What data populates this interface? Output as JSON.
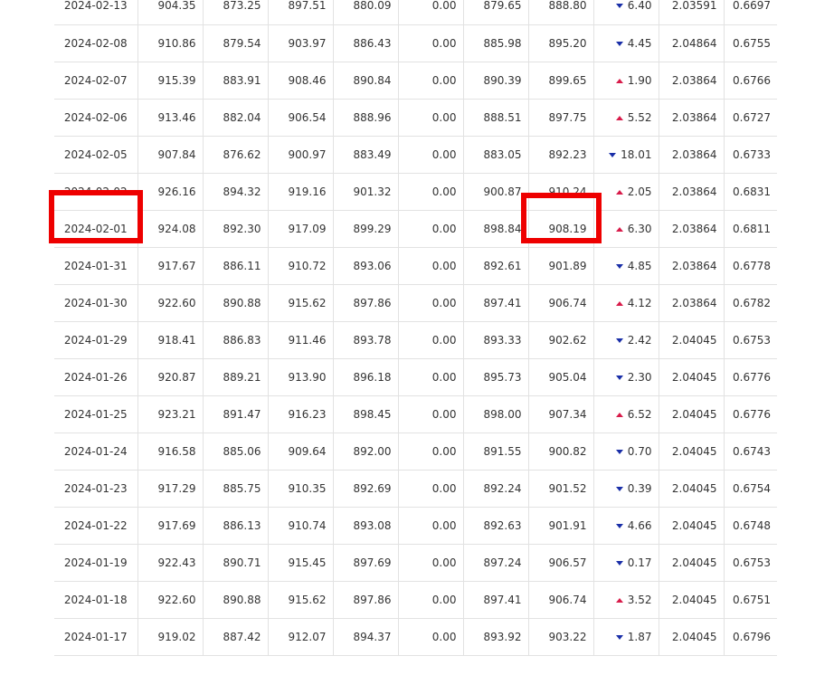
{
  "rows": [
    {
      "date": "2024-02-13",
      "c1": "904.35",
      "c2": "873.25",
      "c3": "897.51",
      "c4": "880.09",
      "c5": "0.00",
      "c6": "879.65",
      "c7": "888.80",
      "dir": "down",
      "chg": "6.40",
      "c9": "2.03591",
      "c10": "0.6697"
    },
    {
      "date": "2024-02-08",
      "c1": "910.86",
      "c2": "879.54",
      "c3": "903.97",
      "c4": "886.43",
      "c5": "0.00",
      "c6": "885.98",
      "c7": "895.20",
      "dir": "down",
      "chg": "4.45",
      "c9": "2.04864",
      "c10": "0.6755"
    },
    {
      "date": "2024-02-07",
      "c1": "915.39",
      "c2": "883.91",
      "c3": "908.46",
      "c4": "890.84",
      "c5": "0.00",
      "c6": "890.39",
      "c7": "899.65",
      "dir": "up",
      "chg": "1.90",
      "c9": "2.03864",
      "c10": "0.6766"
    },
    {
      "date": "2024-02-06",
      "c1": "913.46",
      "c2": "882.04",
      "c3": "906.54",
      "c4": "888.96",
      "c5": "0.00",
      "c6": "888.51",
      "c7": "897.75",
      "dir": "up",
      "chg": "5.52",
      "c9": "2.03864",
      "c10": "0.6727"
    },
    {
      "date": "2024-02-05",
      "c1": "907.84",
      "c2": "876.62",
      "c3": "900.97",
      "c4": "883.49",
      "c5": "0.00",
      "c6": "883.05",
      "c7": "892.23",
      "dir": "down",
      "chg": "18.01",
      "c9": "2.03864",
      "c10": "0.6733"
    },
    {
      "date": "2024-02-02",
      "c1": "926.16",
      "c2": "894.32",
      "c3": "919.16",
      "c4": "901.32",
      "c5": "0.00",
      "c6": "900.87",
      "c7": "910.24",
      "dir": "up",
      "chg": "2.05",
      "c9": "2.03864",
      "c10": "0.6831"
    },
    {
      "date": "2024-02-01",
      "c1": "924.08",
      "c2": "892.30",
      "c3": "917.09",
      "c4": "899.29",
      "c5": "0.00",
      "c6": "898.84",
      "c7": "908.19",
      "dir": "up",
      "chg": "6.30",
      "c9": "2.03864",
      "c10": "0.6811"
    },
    {
      "date": "2024-01-31",
      "c1": "917.67",
      "c2": "886.11",
      "c3": "910.72",
      "c4": "893.06",
      "c5": "0.00",
      "c6": "892.61",
      "c7": "901.89",
      "dir": "down",
      "chg": "4.85",
      "c9": "2.03864",
      "c10": "0.6778"
    },
    {
      "date": "2024-01-30",
      "c1": "922.60",
      "c2": "890.88",
      "c3": "915.62",
      "c4": "897.86",
      "c5": "0.00",
      "c6": "897.41",
      "c7": "906.74",
      "dir": "up",
      "chg": "4.12",
      "c9": "2.03864",
      "c10": "0.6782"
    },
    {
      "date": "2024-01-29",
      "c1": "918.41",
      "c2": "886.83",
      "c3": "911.46",
      "c4": "893.78",
      "c5": "0.00",
      "c6": "893.33",
      "c7": "902.62",
      "dir": "down",
      "chg": "2.42",
      "c9": "2.04045",
      "c10": "0.6753"
    },
    {
      "date": "2024-01-26",
      "c1": "920.87",
      "c2": "889.21",
      "c3": "913.90",
      "c4": "896.18",
      "c5": "0.00",
      "c6": "895.73",
      "c7": "905.04",
      "dir": "down",
      "chg": "2.30",
      "c9": "2.04045",
      "c10": "0.6776"
    },
    {
      "date": "2024-01-25",
      "c1": "923.21",
      "c2": "891.47",
      "c3": "916.23",
      "c4": "898.45",
      "c5": "0.00",
      "c6": "898.00",
      "c7": "907.34",
      "dir": "up",
      "chg": "6.52",
      "c9": "2.04045",
      "c10": "0.6776"
    },
    {
      "date": "2024-01-24",
      "c1": "916.58",
      "c2": "885.06",
      "c3": "909.64",
      "c4": "892.00",
      "c5": "0.00",
      "c6": "891.55",
      "c7": "900.82",
      "dir": "down",
      "chg": "0.70",
      "c9": "2.04045",
      "c10": "0.6743"
    },
    {
      "date": "2024-01-23",
      "c1": "917.29",
      "c2": "885.75",
      "c3": "910.35",
      "c4": "892.69",
      "c5": "0.00",
      "c6": "892.24",
      "c7": "901.52",
      "dir": "down",
      "chg": "0.39",
      "c9": "2.04045",
      "c10": "0.6754"
    },
    {
      "date": "2024-01-22",
      "c1": "917.69",
      "c2": "886.13",
      "c3": "910.74",
      "c4": "893.08",
      "c5": "0.00",
      "c6": "892.63",
      "c7": "901.91",
      "dir": "down",
      "chg": "4.66",
      "c9": "2.04045",
      "c10": "0.6748"
    },
    {
      "date": "2024-01-19",
      "c1": "922.43",
      "c2": "890.71",
      "c3": "915.45",
      "c4": "897.69",
      "c5": "0.00",
      "c6": "897.24",
      "c7": "906.57",
      "dir": "down",
      "chg": "0.17",
      "c9": "2.04045",
      "c10": "0.6753"
    },
    {
      "date": "2024-01-18",
      "c1": "922.60",
      "c2": "890.88",
      "c3": "915.62",
      "c4": "897.86",
      "c5": "0.00",
      "c6": "897.41",
      "c7": "906.74",
      "dir": "up",
      "chg": "3.52",
      "c9": "2.04045",
      "c10": "0.6751"
    },
    {
      "date": "2024-01-17",
      "c1": "919.02",
      "c2": "887.42",
      "c3": "912.07",
      "c4": "894.37",
      "c5": "0.00",
      "c6": "893.92",
      "c7": "903.22",
      "dir": "down",
      "chg": "1.87",
      "c9": "2.04045",
      "c10": "0.6796"
    }
  ],
  "colors": {
    "up": "#d81b4a",
    "down": "#1a2fa8",
    "highlight": "#ee0000",
    "grid": "#e2e2e2",
    "text": "#333333"
  },
  "icons": {
    "up": "triangle-up-icon",
    "down": "triangle-down-icon"
  }
}
